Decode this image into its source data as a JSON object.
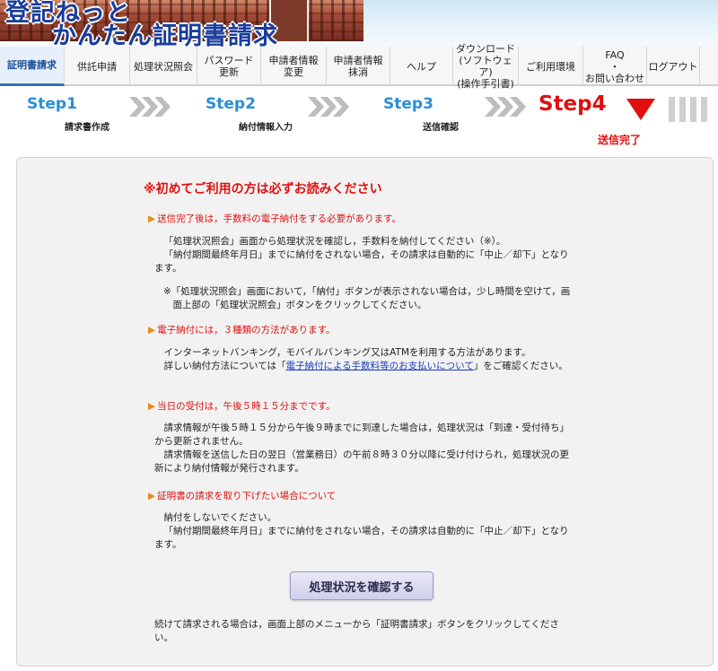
{
  "banner": {
    "logo_line1": "登記ねっと",
    "logo_line2": "かんたん証明書請求"
  },
  "nav": [
    {
      "label": "証明書請求",
      "active": true
    },
    {
      "label": "供託申請"
    },
    {
      "label": "処理状況照会"
    },
    {
      "label": "パスワード\n更新"
    },
    {
      "label": "申請者情報\n変更"
    },
    {
      "label": "申請者情報\n抹消"
    },
    {
      "label": "ヘルプ"
    },
    {
      "label": "ダウンロード\n(ソフトウェア)\n(操作手引書)"
    },
    {
      "label": "ご利用環境"
    },
    {
      "label": "FAQ\n・\nお問い合わせ"
    },
    {
      "label": "ログアウト"
    }
  ],
  "steps": [
    {
      "title": "Step1",
      "label": "請求書作成"
    },
    {
      "title": "Step2",
      "label": "納付情報入力"
    },
    {
      "title": "Step3",
      "label": "送信確認"
    },
    {
      "title": "Step4",
      "label": "送信完了"
    }
  ],
  "notice": {
    "title": "※初めてご利用の方は必ずお読みください",
    "sections": [
      {
        "heading": "送信完了後は，手数料の電子納付をする必要があります。",
        "paragraphs": [
          "「処理状況照会」画面から処理状況を確認し，手数料を納付してください（※）。",
          "「納付期間最終年月日」までに納付をされない場合，その請求は自動的に「中止／却下」となります。",
          "※「処理状況照会」画面において，「納付」ボタンが表示されない場合は，少し時間を空けて，画面上部の「処理状況照会」ボタンをクリックしてください。"
        ]
      },
      {
        "heading": "電子納付には，３種類の方法があります。",
        "paragraphs": [
          "インターネットバンキング，モバイルバンキング又はATMを利用する方法があります。",
          "詳しい納付方法については「",
          "電子納付による手数料等のお支払いについて",
          "」をご確認ください。"
        ]
      },
      {
        "heading": "当日の受付は，午後５時１５分までです。",
        "paragraphs": [
          "請求情報が午後５時１５分から午後９時までに到達した場合は，処理状況は「到達・受付待ち」から更新されません。",
          "請求情報を送信した日の翌日（営業務日）の午前８時３０分以降に受け付けられ，処理状況の更新により納付情報が発行されます。"
        ]
      },
      {
        "heading": "証明書の請求を取り下げたい場合について",
        "paragraphs": [
          "納付をしないでください。",
          "「納付期間最終年月日」までに納付をされない場合，その請求は自動的に「中止／却下」となります。"
        ]
      }
    ],
    "button_label": "処理状況を確認する",
    "footer": "続けて請求される場合は，画面上部のメニューから「証明書請求」ボタンをクリックしてください。"
  },
  "colors": {
    "accent_red": "#e01010",
    "step_blue": "#2a8fd4",
    "link_blue": "#1a3dbd"
  }
}
